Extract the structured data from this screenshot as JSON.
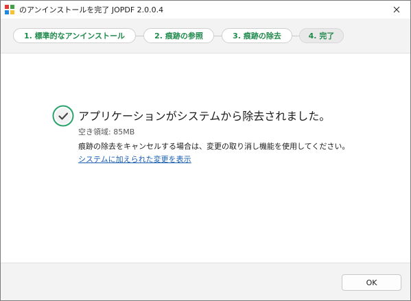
{
  "window": {
    "title": "のアンインストールを完了 JOPDF 2.0.0.4"
  },
  "steps": [
    {
      "label": "1. 標準的なアンインストール"
    },
    {
      "label": "2. 痕跡の参照"
    },
    {
      "label": "3. 痕跡の除去"
    },
    {
      "label": "4. 完了"
    }
  ],
  "main": {
    "headline": "アプリケーションがシステムから除去されました。",
    "space_freed": "空き領域: 85MB",
    "info": "痕跡の除去をキャンセルする場合は、変更の取り消し機能を使用してください。",
    "changes_link": "システムに加えられた変更を表示"
  },
  "footer": {
    "ok_label": "OK"
  },
  "colors": {
    "accent_green": "#1f8a4c",
    "link_blue": "#1a5fb4"
  }
}
